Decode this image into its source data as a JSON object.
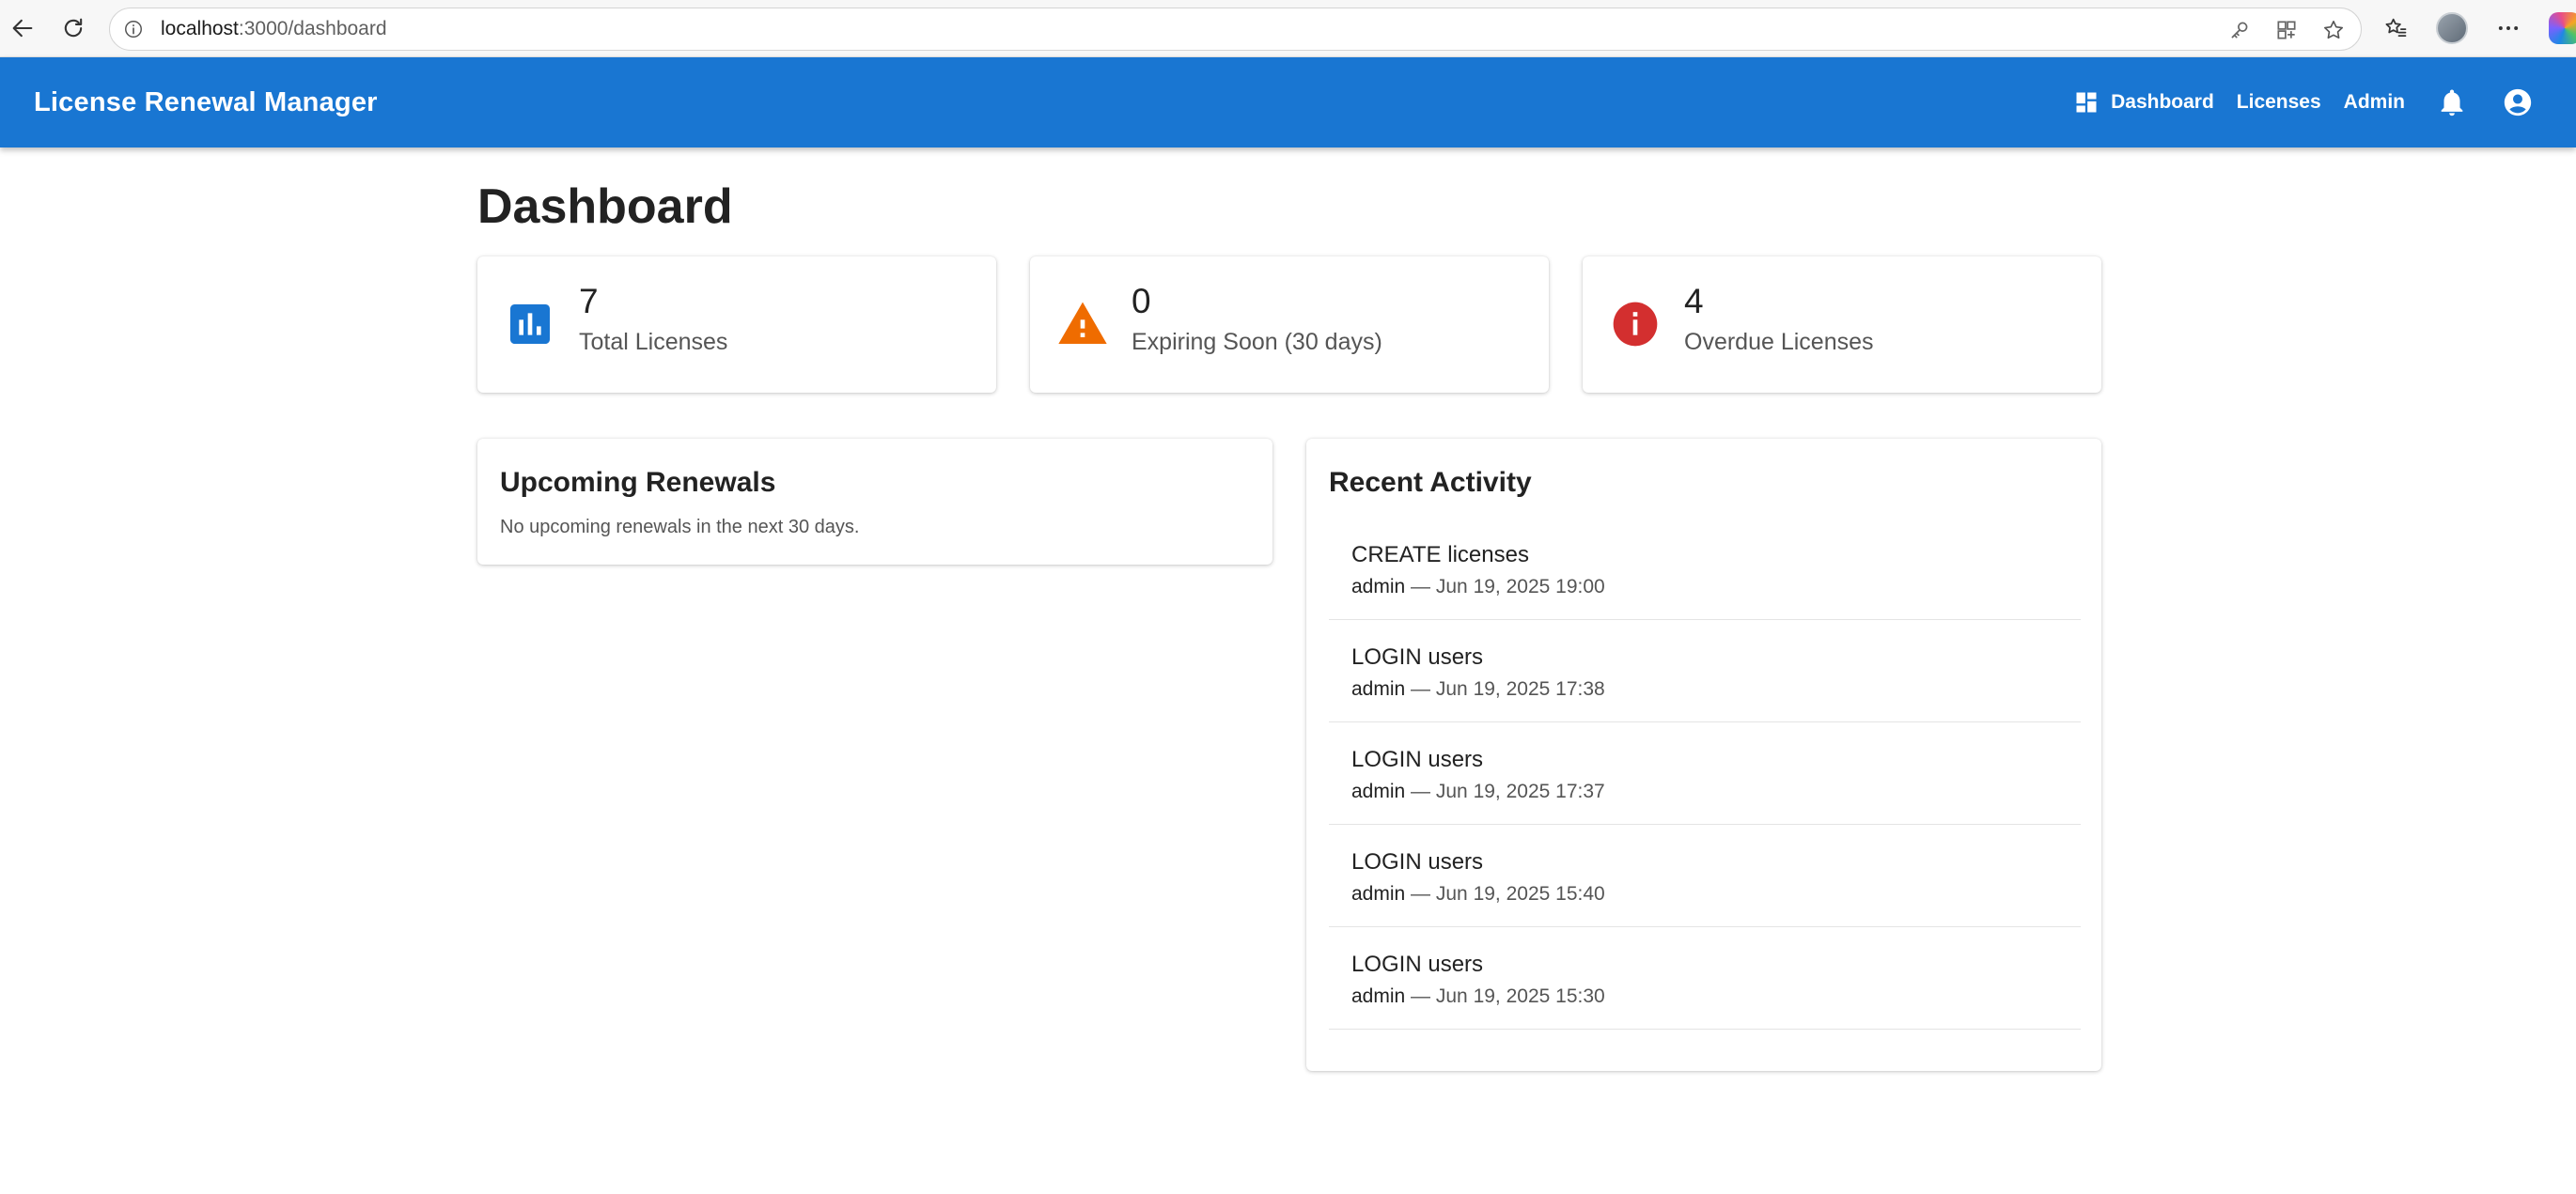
{
  "browser": {
    "url_host": "localhost",
    "url_path": ":3000/dashboard"
  },
  "app_bar": {
    "title": "License Renewal Manager",
    "nav": {
      "dashboard": "Dashboard",
      "licenses": "Licenses",
      "admin": "Admin"
    },
    "color": "#1976d2"
  },
  "page": {
    "title": "Dashboard"
  },
  "stats": [
    {
      "value": "7",
      "label": "Total Licenses",
      "icon": "bar-chart-icon",
      "color": "#1976d2"
    },
    {
      "value": "0",
      "label": "Expiring Soon (30 days)",
      "icon": "warning-icon",
      "color": "#ef6c00"
    },
    {
      "value": "4",
      "label": "Overdue Licenses",
      "icon": "error-icon",
      "color": "#d32f2f"
    }
  ],
  "upcoming_renewals": {
    "title": "Upcoming Renewals",
    "empty_message": "No upcoming renewals in the next 30 days."
  },
  "recent_activity": {
    "title": "Recent Activity",
    "items": [
      {
        "action": "CREATE licenses",
        "user": "admin",
        "timestamp": "Jun 19, 2025 19:00"
      },
      {
        "action": "LOGIN users",
        "user": "admin",
        "timestamp": "Jun 19, 2025 17:38"
      },
      {
        "action": "LOGIN users",
        "user": "admin",
        "timestamp": "Jun 19, 2025 17:37"
      },
      {
        "action": "LOGIN users",
        "user": "admin",
        "timestamp": "Jun 19, 2025 15:40"
      },
      {
        "action": "LOGIN users",
        "user": "admin",
        "timestamp": "Jun 19, 2025 15:30"
      }
    ]
  }
}
